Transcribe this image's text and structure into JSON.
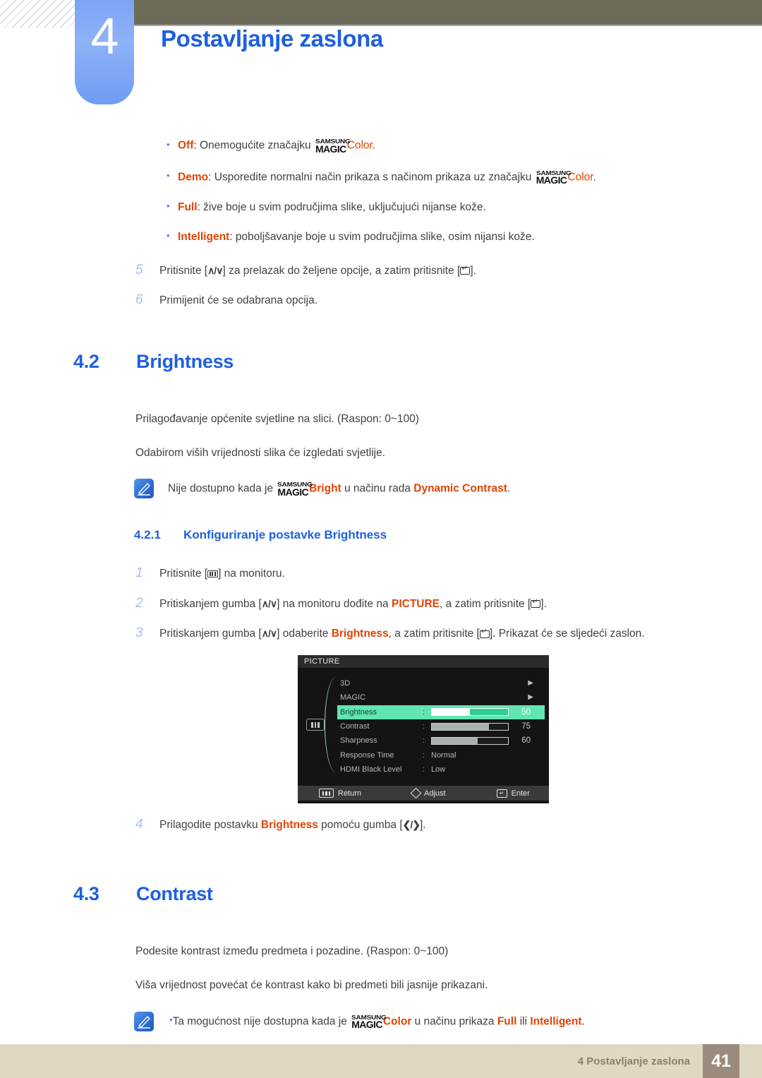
{
  "header": {
    "chapter_number": "4",
    "chapter_title": "Postavljanje zaslona",
    "accent_blue": "#1e5fe0",
    "tab_blue": "#7ba4f5",
    "olive": "#6d6b57"
  },
  "magic_logo": {
    "line1": "SAMSUNG",
    "line2": "MAGIC"
  },
  "bullets": [
    {
      "term": "Off",
      "rest_before": ": Onemogućite značajku ",
      "has_magic": true,
      "magic_suffix": "Color",
      "rest_after": "."
    },
    {
      "term": "Demo",
      "rest_before": ": Usporedite normalni način prikaza s načinom prikaza uz značajku ",
      "has_magic": true,
      "magic_suffix": "Color",
      "rest_after": "."
    },
    {
      "term": "Full",
      "rest_before": ": žive boje u svim područjima slike, uključujući nijanse kože.",
      "has_magic": false,
      "magic_suffix": "",
      "rest_after": ""
    },
    {
      "term": "Intelligent",
      "rest_before": ": poboljšavanje boje u svim područjima slike, osim nijansi kože.",
      "has_magic": false,
      "magic_suffix": "",
      "rest_after": ""
    }
  ],
  "steps_top": [
    {
      "num": "5",
      "a": "Pritisnite [",
      "b": "] za prelazak do željene opcije, a zatim pritisnite [",
      "c": "]."
    },
    {
      "num": "6",
      "a": "Primijenit će se odabrana opcija.",
      "b": "",
      "c": ""
    }
  ],
  "section_42": {
    "number": "4.2",
    "title": "Brightness",
    "para1": "Prilagođavanje općenite svjetline na slici. (Raspon: 0~100)",
    "para2": "Odabirom viših vrijednosti slika će izgledati svjetlije.",
    "note_before": "Nije dostupno kada je ",
    "note_magic_suffix": "Bright",
    "note_middle": " u načinu rada ",
    "note_highlight": "Dynamic Contrast",
    "note_after": "."
  },
  "section_421": {
    "number": "4.2.1",
    "title": "Konfiguriranje postavke Brightness",
    "steps": [
      {
        "num": "1",
        "p1": "Pritisnite [",
        "p2": "] na monitoru.",
        "p3": "",
        "p4": "",
        "kind": "menu-key"
      },
      {
        "num": "2",
        "p1": "Pritiskanjem gumba [",
        "p2": "] na monitoru dođite na ",
        "hl": "PICTURE",
        "p3": ", a zatim pritisnite [",
        "p4": "].",
        "kind": "updown"
      },
      {
        "num": "3",
        "p1": "Pritiskanjem gumba [",
        "p2": "] odaberite ",
        "hl": "Brightness",
        "p3": ", a zatim pritisnite [",
        "p4": "]. Prikazat će se sljedeći zaslon.",
        "kind": "updown"
      }
    ],
    "step4": {
      "num": "4",
      "p1": "Prilagodite postavku ",
      "hl": "Brightness",
      "p2": " pomoću gumba [",
      "p3": "]."
    }
  },
  "osd": {
    "header_title": "PICTURE",
    "rows": [
      {
        "label": "3D",
        "type": "arrow",
        "value": "",
        "selected": false
      },
      {
        "label": "MAGIC",
        "type": "arrow",
        "value": "",
        "selected": false
      },
      {
        "label": "Brightness",
        "type": "slider",
        "value": "50",
        "fill_pct": 50,
        "selected": true
      },
      {
        "label": "Contrast",
        "type": "slider",
        "value": "75",
        "fill_pct": 75,
        "selected": false
      },
      {
        "label": "Sharpness",
        "type": "slider",
        "value": "60",
        "fill_pct": 60,
        "selected": false
      },
      {
        "label": "Response Time",
        "type": "text",
        "value": "Normal",
        "selected": false
      },
      {
        "label": "HDMI Black Level",
        "type": "text",
        "value": "Low",
        "selected": false
      }
    ],
    "footer": {
      "return": "Return",
      "adjust": "Adjust",
      "enter": "Enter"
    },
    "highlight_color": "#62e6b0"
  },
  "section_43": {
    "number": "4.3",
    "title": "Contrast",
    "para1": "Podesite kontrast između predmeta i pozadine. (Raspon: 0~100)",
    "para2": "Viša vrijednost povećat će kontrast kako bi predmeti bili jasnije prikazani.",
    "note_before": "Ta mogućnost nije dostupna kada je ",
    "note_magic_suffix": "Color",
    "note_middle": " u načinu prikaza ",
    "note_hl1": "Full",
    "note_between": " ili ",
    "note_hl2": "Intelligent",
    "note_after": "."
  },
  "footer": {
    "text": "4 Postavljanje zaslona",
    "page": "41"
  }
}
